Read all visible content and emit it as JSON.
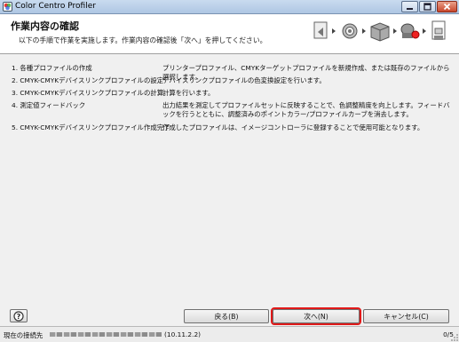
{
  "window": {
    "title": "Color Centro Profiler"
  },
  "header": {
    "title": "作業内容の確認",
    "description": "以下の手順で作業を実施します。作業内容の確認後「次へ」を押してください。",
    "step_icons": [
      "document-icon",
      "gear-icon",
      "printer-icon",
      "measure-icon",
      "profile-icon"
    ]
  },
  "tasks": [
    {
      "name": "1. 各種プロファイルの作成",
      "desc": "プリンタープロファイル、CMYKターゲットプロファイルを新規作成、または既存のファイルから選択します。"
    },
    {
      "name": "2. CMYK-CMYKデバイスリンクプロファイルの設定",
      "desc": "デバイスリンクプロファイルの色変換設定を行います。"
    },
    {
      "name": "3. CMYK-CMYKデバイスリンクプロファイルの計算",
      "desc": "計算を行います。"
    },
    {
      "name": "4. 測定値フィードバック",
      "desc": "出力結果を測定してプロファイルセットに反映することで、色調整精度を向上します。フィードバックを行うとともに、調整済みのポイントカラー/プロファイルカーブを消去します。"
    },
    {
      "name": "5. CMYK-CMYKデバイスリンクプロファイル作成完了",
      "desc": "作成したプロファイルは、イメージコントローラに登録することで使用可能となります。"
    }
  ],
  "buttons": {
    "help": "?",
    "back": "戻る(B)",
    "next": "次へ(N)",
    "cancel": "キャンセル(C)"
  },
  "status": {
    "label": "現在の接続先",
    "ip": "(10.11.2.2)",
    "page": "0/5"
  },
  "colors": {
    "highlight": "#e01919",
    "titlebar": "#aec6e3"
  }
}
